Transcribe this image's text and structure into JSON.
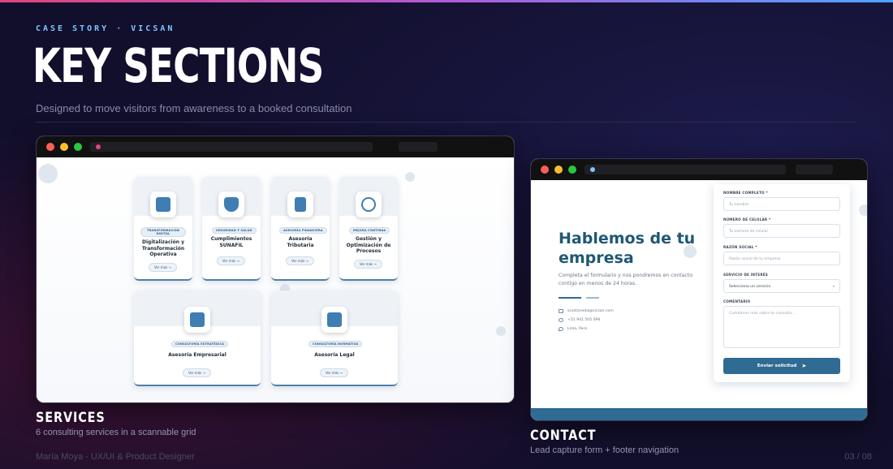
{
  "header": {
    "eyebrow": "CASE STORY · VICSAN",
    "title": "KEY SECTIONS",
    "subtitle": "Designed to move visitors from awareness to a booked consultation"
  },
  "services_window": {
    "cards": [
      {
        "badge": "TRANSFORMACIÓN DIGITAL",
        "title": "Digitalización y Transformación Operativa",
        "button": "Ver más →",
        "icon": "digital-transform-icon"
      },
      {
        "badge": "SEGURIDAD Y SALUD",
        "title": "Cumplimientos SUNAFIL",
        "button": "Ver más →",
        "icon": "shield-icon"
      },
      {
        "badge": "ASESORÍA FINANCIERA",
        "title": "Asesoría Tributaria",
        "button": "Ver más →",
        "icon": "calculator-icon"
      },
      {
        "badge": "MEJORA CONTINUA",
        "title": "Gestión y Optimización de Procesos",
        "button": "Ver más →",
        "icon": "process-icon"
      },
      {
        "badge": "CONSULTORÍA ESTRATÉGICA",
        "title": "Asesoría Empresarial",
        "button": "Ver más →",
        "icon": "bar-chart-icon"
      },
      {
        "badge": "CONSULTORÍA NORMATIVA",
        "title": "Asesoría Legal",
        "button": "Ver más →",
        "icon": "legal-icon"
      }
    ],
    "caption_title": "SERVICES",
    "caption_desc": "6 consulting services in a scannable grid"
  },
  "contact_window": {
    "heading_line1": "Hablemos de tu",
    "heading_line2": "empresa",
    "lead": "Completa el formulario y nos pondremos en contacto contigo en menos de 24 horas.",
    "email": "scastaneda@vicsan.com",
    "phone": "+51 941 505 096",
    "location": "Lima, Perú",
    "form": {
      "name_label": "NOMBRE COMPLETO *",
      "name_placeholder": "Tu nombre",
      "phone_label": "NÚMERO DE CELULAR *",
      "phone_placeholder": "Tu número de celular",
      "company_label": "RAZÓN SOCIAL *",
      "company_placeholder": "Razón social de tu empresa",
      "service_label": "SERVICIO DE INTERÉS",
      "service_value": "Selecciona un servicio",
      "comment_label": "COMENTARIO",
      "comment_placeholder": "Cuéntanos más sobre tu consulta...",
      "submit": "Enviar solicitud"
    },
    "caption_title": "CONTACT",
    "caption_desc": "Lead capture form + footer navigation"
  },
  "footer": {
    "author": "María Moya - UX/UI & Product Designer",
    "page": "03 / 08"
  },
  "colors": {
    "accent_blue": "#2f6b93",
    "bg": "#120f2c"
  }
}
